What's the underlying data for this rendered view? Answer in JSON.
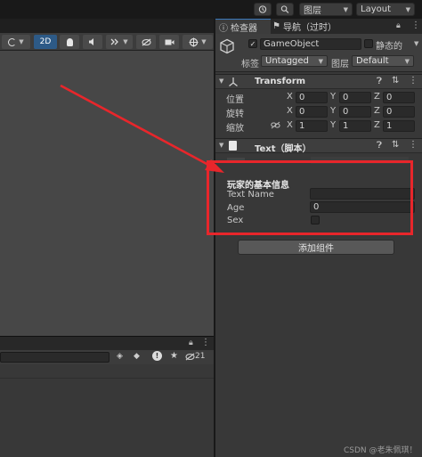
{
  "toolbar": {
    "layers_label": "图层",
    "layout_label": "Layout"
  },
  "scene_toolbar": {
    "mode_2d": "2D"
  },
  "bottom_panel": {
    "hidden_count": "21"
  },
  "inspector": {
    "tabs": [
      {
        "label": "检查器"
      },
      {
        "label": "导航（过时）"
      }
    ],
    "gameobject": {
      "name": "GameObject",
      "static_label": "静态的",
      "tag_label": "标签",
      "tag_value": "Untagged",
      "layer_label": "图层",
      "layer_value": "Default"
    },
    "transform": {
      "title": "Transform",
      "rows": [
        {
          "label": "位置",
          "x": "0",
          "y": "0",
          "z": "0"
        },
        {
          "label": "旋转",
          "x": "0",
          "y": "0",
          "z": "0"
        },
        {
          "label": "缩放",
          "x": "1",
          "y": "1",
          "z": "1"
        }
      ],
      "axis_x": "X",
      "axis_y": "Y",
      "axis_z": "Z"
    },
    "text_script": {
      "title": "Text（脚本）",
      "header": "玩家的基本信息",
      "fields": [
        {
          "label": "Text Name",
          "value": ""
        },
        {
          "label": "Age",
          "value": "0"
        },
        {
          "label": "Sex",
          "value": ""
        }
      ]
    },
    "add_component_label": "添加组件"
  },
  "watermark": "CSDN @老朱佩琪！",
  "colors": {
    "highlight": "#e8262b",
    "accent": "#3a79bb"
  }
}
